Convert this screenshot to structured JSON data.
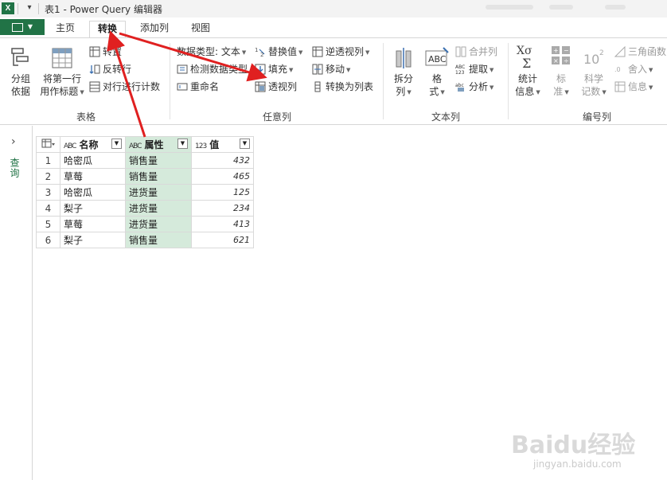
{
  "titlebar": {
    "app_logo": "X",
    "title": "表1 - Power Query 编辑器"
  },
  "tabs": {
    "file_icon": "file-menu-icon",
    "items": [
      {
        "label": "主页"
      },
      {
        "label": "转换",
        "active": true
      },
      {
        "label": "添加列"
      },
      {
        "label": "视图"
      }
    ]
  },
  "ribbon": {
    "table_group": {
      "label": "表格",
      "group_by": {
        "line1": "分组",
        "line2": "依据"
      },
      "use_first_row": {
        "line1": "将第一行",
        "line2": "用作标题"
      },
      "transpose": "转置",
      "reverse_rows": "反转行",
      "count_rows": "对行进行计数"
    },
    "any_column_group": {
      "label": "任意列",
      "data_type": "数据类型: 文本",
      "detect_type": "检测数据类型",
      "rename": "重命名",
      "replace_values": "替换值",
      "fill": "填充",
      "pivot_column": "透视列",
      "unpivot_columns": "逆透视列",
      "move": "移动",
      "convert_to_list": "转换为列表"
    },
    "text_column_group": {
      "label": "文本列",
      "split": {
        "line1": "拆分",
        "line2": "列"
      },
      "format": {
        "line1": "格",
        "line2": "式"
      },
      "merge_columns": "合并列",
      "extract": "提取",
      "parse": "分析"
    },
    "number_column_group": {
      "label": "编号列",
      "statistics": {
        "line1": "统计",
        "line2": "信息"
      },
      "standard": {
        "line1": "标",
        "line2": "准"
      },
      "scientific": {
        "line1": "科学",
        "line2": "记数"
      },
      "trigonometry": "三角函数",
      "rounding": "舍入",
      "information": "信息"
    }
  },
  "left_pane": {
    "label": "查询"
  },
  "grid": {
    "headers": [
      {
        "type": "ABC",
        "name": "名称"
      },
      {
        "type": "ABC",
        "name": "属性",
        "selected": true
      },
      {
        "type": "123",
        "name": "值"
      }
    ],
    "rows": [
      {
        "n": "1",
        "name": "哈密瓜",
        "attr": "销售量",
        "value": "432"
      },
      {
        "n": "2",
        "name": "草莓",
        "attr": "销售量",
        "value": "465"
      },
      {
        "n": "3",
        "name": "哈密瓜",
        "attr": "进货量",
        "value": "125"
      },
      {
        "n": "4",
        "name": "梨子",
        "attr": "进货量",
        "value": "234"
      },
      {
        "n": "5",
        "name": "草莓",
        "attr": "进货量",
        "value": "413"
      },
      {
        "n": "6",
        "name": "梨子",
        "attr": "销售量",
        "value": "621"
      }
    ]
  },
  "watermark": {
    "logo": "Baidu经验",
    "url": "jingyan.baidu.com"
  },
  "colors": {
    "excel_green": "#217346",
    "selected_column": "#d5eadb",
    "annotation_arrow": "#e02020"
  }
}
